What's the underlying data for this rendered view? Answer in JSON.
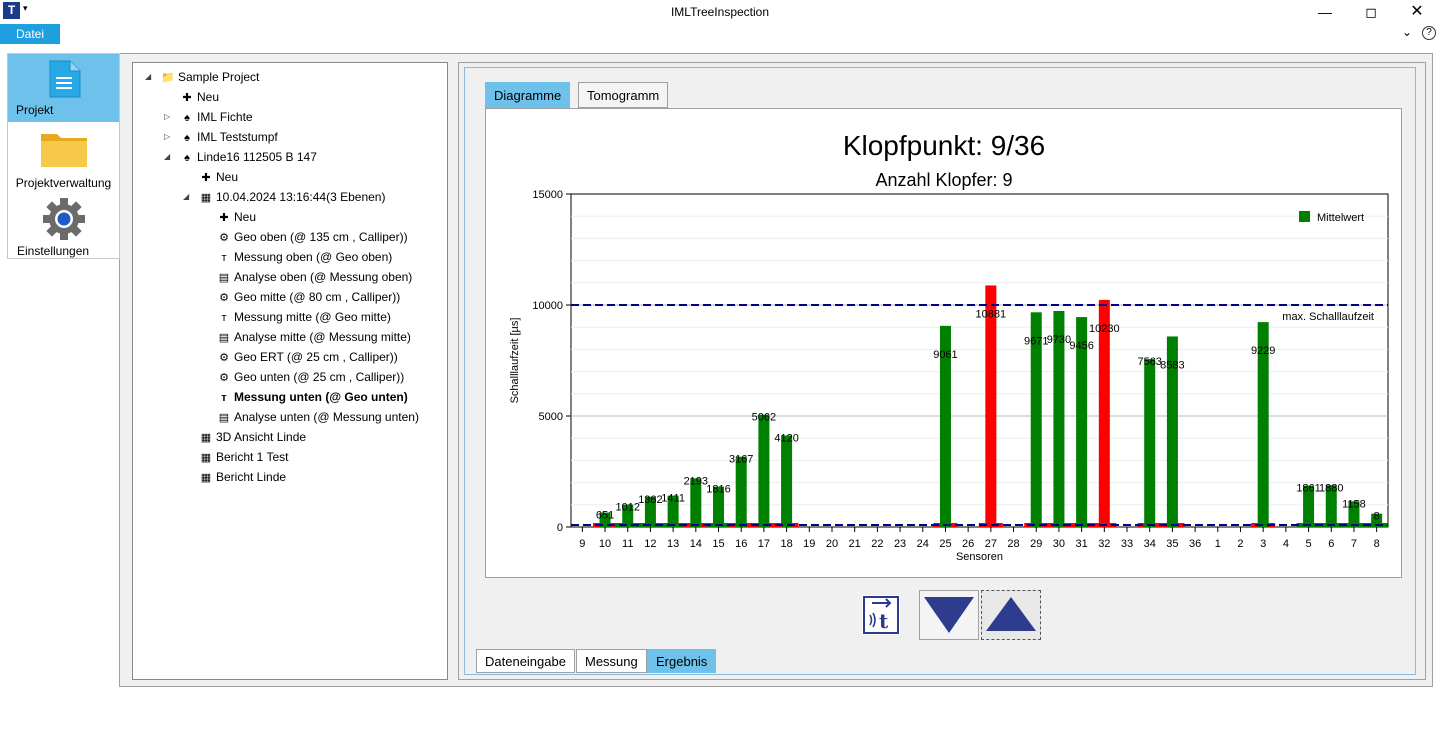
{
  "window": {
    "title": "IMLTreeInspection"
  },
  "menu": {
    "file": "Datei"
  },
  "nav": {
    "items": [
      {
        "label": "Projekt",
        "icon": "document-icon"
      },
      {
        "label": "Projektverwaltung",
        "icon": "folder-icon"
      },
      {
        "label": "Einstellungen",
        "icon": "gear-icon"
      }
    ]
  },
  "tree": {
    "nodes": [
      {
        "label": "Sample Project",
        "icon": "project-icon",
        "expander": "open",
        "level": 0
      },
      {
        "label": "Neu",
        "icon": "plus-icon",
        "level": 1
      },
      {
        "label": "IML Fichte",
        "icon": "tree-icon",
        "expander": "closed",
        "level": 1
      },
      {
        "label": "IML Teststumpf",
        "icon": "tree-icon",
        "expander": "closed",
        "level": 1
      },
      {
        "label": "Linde16 112505 B 147",
        "icon": "tree-icon",
        "expander": "open",
        "level": 1
      },
      {
        "label": "Neu",
        "icon": "plus-icon",
        "level": 2
      },
      {
        "label": "10.04.2024 13:16:44(3 Ebenen)",
        "icon": "grid-icon",
        "expander": "open",
        "level": 2
      },
      {
        "label": "Neu",
        "icon": "plus-icon",
        "level": 3
      },
      {
        "label": "Geo oben (@ 135 cm , Calliper))",
        "icon": "geo-icon",
        "level": 3
      },
      {
        "label": "Messung oben (@ Geo oben)",
        "icon": "measure-icon",
        "level": 3
      },
      {
        "label": "Analyse oben (@ Messung oben)",
        "icon": "analysis-icon",
        "level": 3
      },
      {
        "label": "Geo mitte (@ 80 cm , Calliper))",
        "icon": "geo-icon",
        "level": 3
      },
      {
        "label": "Messung mitte (@ Geo mitte)",
        "icon": "measure-icon",
        "level": 3
      },
      {
        "label": "Analyse mitte (@ Messung mitte)",
        "icon": "analysis-icon",
        "level": 3
      },
      {
        "label": "Geo ERT (@ 25 cm , Calliper))",
        "icon": "geo-icon",
        "level": 3
      },
      {
        "label": "Geo unten (@ 25 cm , Calliper))",
        "icon": "geo-icon",
        "level": 3
      },
      {
        "label": "Messung unten (@ Geo unten)",
        "icon": "measure-icon",
        "level": 3,
        "bold": true
      },
      {
        "label": "Analyse unten (@ Messung unten)",
        "icon": "analysis-icon",
        "level": 3
      },
      {
        "label": "3D Ansicht Linde",
        "icon": "grid-icon",
        "level": 2
      },
      {
        "label": "Bericht 1 Test",
        "icon": "grid-icon",
        "level": 2
      },
      {
        "label": "Bericht Linde",
        "icon": "grid-icon",
        "level": 2
      }
    ]
  },
  "tabs_top": [
    "Diagramme",
    "Tomogramm"
  ],
  "tabs_bottom": [
    "Dateneingabe",
    "Messung",
    "Ergebnis"
  ],
  "buttons": {
    "sound_time": "sound-time-icon",
    "down": "triangle-down-icon",
    "up": "triangle-up-icon"
  },
  "colors": {
    "accent": "#1e9fe0",
    "tab_active": "#6ec1ea",
    "bar_ok": "#008000",
    "bar_bad": "#ff0000",
    "threshold": "#00008b"
  },
  "chart_data": {
    "type": "bar",
    "title": "Klopfpunkt: 9/36",
    "subtitle": "Anzahl Klopfer: 9",
    "xlabel": "Sensoren",
    "ylabel": "Schalllaufzeit [µs]",
    "ylim": [
      0,
      15000
    ],
    "yticks": [
      0,
      5000,
      10000,
      15000
    ],
    "legend": {
      "label": "Mittelwert",
      "position": "top-right"
    },
    "threshold": {
      "value": 10000,
      "label": "max. Schalllaufzeit"
    },
    "categories": [
      "9",
      "10",
      "11",
      "12",
      "13",
      "14",
      "15",
      "16",
      "17",
      "18",
      "19",
      "20",
      "21",
      "22",
      "23",
      "24",
      "25",
      "26",
      "27",
      "28",
      "29",
      "30",
      "31",
      "32",
      "33",
      "34",
      "35",
      "36",
      "1",
      "2",
      "3",
      "4",
      "5",
      "6",
      "7",
      "8"
    ],
    "values": [
      null,
      651,
      1012,
      1362,
      1411,
      2193,
      1816,
      3167,
      5062,
      4120,
      null,
      null,
      null,
      null,
      null,
      null,
      9061,
      null,
      10881,
      null,
      9671,
      9730,
      9456,
      10230,
      null,
      7563,
      8583,
      null,
      null,
      null,
      9229,
      null,
      1861,
      1880,
      1158,
      600
    ],
    "labels": [
      "",
      "651",
      "1012",
      "1362",
      "1411",
      "2193",
      "1816",
      "3167",
      "5062",
      "4120",
      "",
      "",
      "",
      "",
      "",
      "",
      "9061",
      "",
      "10881",
      "",
      "9671",
      "9730",
      "9456",
      "10230",
      "",
      "7563",
      "8583",
      "",
      "",
      "",
      "9229",
      "",
      "1861",
      "1880",
      "1158",
      "8"
    ],
    "colors": [
      "",
      "g",
      "g",
      "g",
      "g",
      "g",
      "g",
      "g",
      "g",
      "g",
      "",
      "",
      "",
      "",
      "",
      "",
      "g",
      "",
      "r",
      "",
      "g",
      "g",
      "g",
      "r",
      "",
      "g",
      "g",
      "",
      "",
      "",
      "g",
      "",
      "g",
      "g",
      "g",
      "g"
    ],
    "base_markers": [
      "",
      "r",
      "g",
      "g",
      "g",
      "r",
      "g",
      "r",
      "r",
      "r",
      "",
      "",
      "",
      "",
      "",
      "",
      "r",
      "",
      "r",
      "",
      "r",
      "r",
      "r",
      "r",
      "",
      "r",
      "r",
      "",
      "",
      "",
      "r",
      "",
      "g",
      "g",
      "g",
      "g"
    ]
  }
}
